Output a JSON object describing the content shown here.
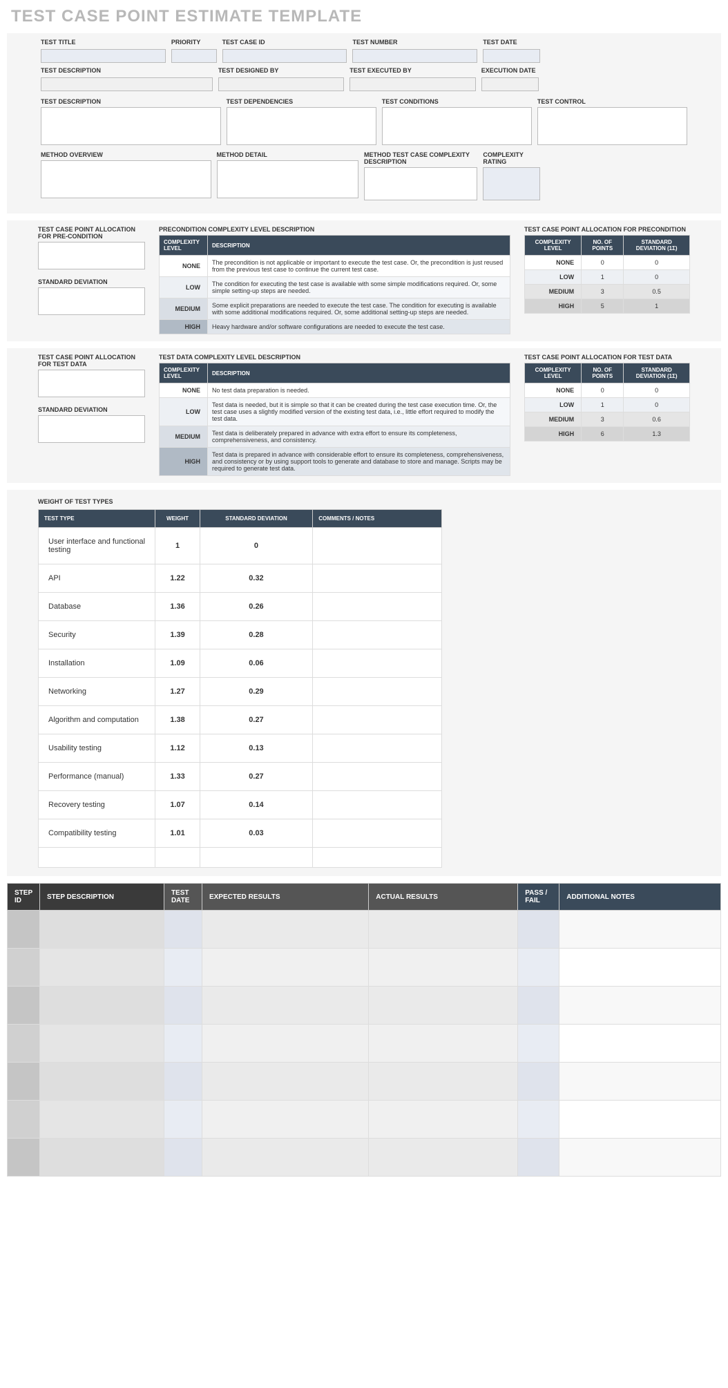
{
  "title": "TEST CASE POINT ESTIMATE TEMPLATE",
  "header_row1": {
    "test_title": "TEST TITLE",
    "priority": "PRIORITY",
    "test_case_id": "TEST CASE ID",
    "test_number": "TEST NUMBER",
    "test_date": "TEST DATE"
  },
  "header_row2": {
    "test_description": "TEST DESCRIPTION",
    "test_designed_by": "TEST DESIGNED BY",
    "test_executed_by": "TEST EXECUTED BY",
    "execution_date": "EXECUTION DATE"
  },
  "header_row3": {
    "test_description": "TEST DESCRIPTION",
    "test_dependencies": "TEST DEPENDENCIES",
    "test_conditions": "TEST CONDITIONS",
    "test_control": "TEST CONTROL"
  },
  "header_row4": {
    "method_overview": "METHOD OVERVIEW",
    "method_detail": "METHOD DETAIL",
    "method_complexity_desc": "METHOD TEST CASE COMPLEXITY DESCRIPTION",
    "complexity_rating": "COMPLEXITY RATING"
  },
  "precondition": {
    "left_label1": "TEST CASE POINT ALLOCATION FOR PRE-CONDITION",
    "left_label2": "STANDARD DEVIATION",
    "desc_title": "PRECONDITION COMPLEXITY LEVEL DESCRIPTION",
    "alloc_title": "TEST CASE POINT ALLOCATION FOR PRECONDITION",
    "cols": {
      "level": "COMPLEXITY LEVEL",
      "desc": "DESCRIPTION",
      "points": "NO. OF POINTS",
      "sd": "STANDARD DEVIATION (1σ)"
    },
    "rows": [
      {
        "level": "NONE",
        "desc": "The precondition is not applicable or important to execute the test case. Or, the precondition is just reused from the previous test case to continue the current test case.",
        "points": "0",
        "sd": "0"
      },
      {
        "level": "LOW",
        "desc": "The condition for executing the test case is available with some simple modifications required. Or, some simple setting-up steps are needed.",
        "points": "1",
        "sd": "0"
      },
      {
        "level": "MEDIUM",
        "desc": "Some explicit preparations are needed to execute the test case. The condition for executing is available with some additional modifications required. Or, some additional setting-up steps are needed.",
        "points": "3",
        "sd": "0.5"
      },
      {
        "level": "HIGH",
        "desc": "Heavy hardware and/or software configurations are needed to execute the test case.",
        "points": "5",
        "sd": "1"
      }
    ]
  },
  "testdata": {
    "left_label1": "TEST CASE POINT ALLOCATION FOR TEST DATA",
    "left_label2": "STANDARD DEVIATION",
    "desc_title": "TEST DATA COMPLEXITY LEVEL DESCRIPTION",
    "alloc_title": "TEST CASE POINT ALLOCATION FOR TEST DATA",
    "cols": {
      "level": "COMPLEXITY LEVEL",
      "desc": "DESCRIPTION",
      "points": "NO. OF POINTS",
      "sd": "STANDARD DEVIATION (1σ)"
    },
    "rows": [
      {
        "level": "NONE",
        "desc": "No test data preparation is needed.",
        "points": "0",
        "sd": "0"
      },
      {
        "level": "LOW",
        "desc": "Test data is needed, but it is simple so that it can be created during the test case execution time. Or, the test case uses a slightly modified version of the existing test data, i.e., little effort required to modify the test data.",
        "points": "1",
        "sd": "0"
      },
      {
        "level": "MEDIUM",
        "desc": "Test data is deliberately prepared in advance with extra effort to ensure its completeness, comprehensiveness, and consistency.",
        "points": "3",
        "sd": "0.6"
      },
      {
        "level": "HIGH",
        "desc": "Test data is prepared in advance with considerable effort to ensure its completeness, comprehensiveness, and consistency or by using support tools to generate and database to store and manage. Scripts may be required to generate test data.",
        "points": "6",
        "sd": "1.3"
      }
    ]
  },
  "weights": {
    "title": "WEIGHT OF TEST TYPES",
    "cols": {
      "type": "TEST TYPE",
      "weight": "WEIGHT",
      "sd": "STANDARD DEVIATION",
      "comments": "COMMENTS / NOTES"
    },
    "rows": [
      {
        "type": "User interface and functional testing",
        "weight": "1",
        "sd": "0",
        "comments": ""
      },
      {
        "type": "API",
        "weight": "1.22",
        "sd": "0.32",
        "comments": ""
      },
      {
        "type": "Database",
        "weight": "1.36",
        "sd": "0.26",
        "comments": ""
      },
      {
        "type": "Security",
        "weight": "1.39",
        "sd": "0.28",
        "comments": ""
      },
      {
        "type": "Installation",
        "weight": "1.09",
        "sd": "0.06",
        "comments": ""
      },
      {
        "type": "Networking",
        "weight": "1.27",
        "sd": "0.29",
        "comments": ""
      },
      {
        "type": "Algorithm and computation",
        "weight": "1.38",
        "sd": "0.27",
        "comments": ""
      },
      {
        "type": "Usability testing",
        "weight": "1.12",
        "sd": "0.13",
        "comments": ""
      },
      {
        "type": "Performance (manual)",
        "weight": "1.33",
        "sd": "0.27",
        "comments": ""
      },
      {
        "type": "Recovery testing",
        "weight": "1.07",
        "sd": "0.14",
        "comments": ""
      },
      {
        "type": "Compatibility testing",
        "weight": "1.01",
        "sd": "0.03",
        "comments": ""
      },
      {
        "type": "",
        "weight": "",
        "sd": "",
        "comments": ""
      }
    ]
  },
  "steps": {
    "cols": {
      "id": "STEP ID",
      "desc": "STEP DESCRIPTION",
      "date": "TEST DATE",
      "exp": "EXPECTED RESULTS",
      "act": "ACTUAL RESULTS",
      "pf": "PASS / FAIL",
      "notes": "ADDITIONAL NOTES"
    },
    "row_count": 7
  }
}
